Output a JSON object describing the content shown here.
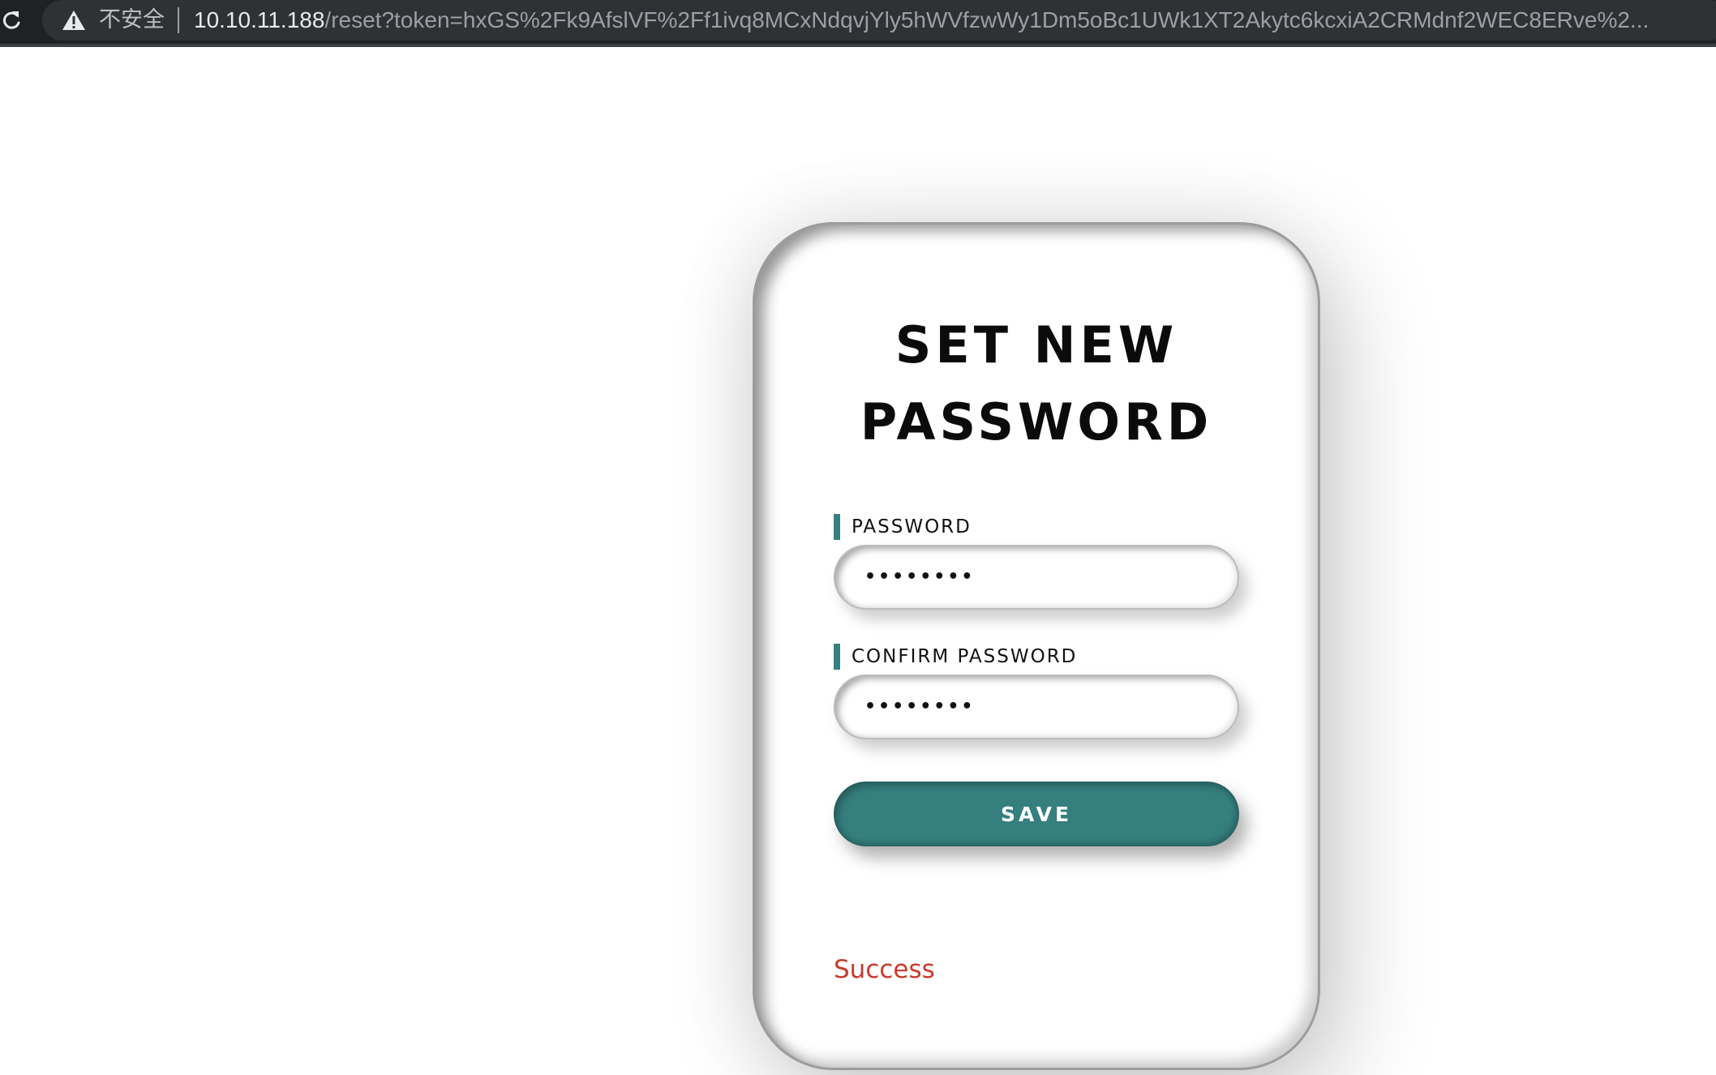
{
  "browser": {
    "security_label": "不安全",
    "url_host": "10.10.11.188",
    "url_path": "/reset?token=hxGS%2Fk9AfslVF%2Ff1ivq8MCxNdqvjYly5hWVfzwWy1Dm5oBc1UWk1XT2Akytc6kcxiA2CRMdnf2WEC8ERve%2...",
    "reload_icon": "reload-icon",
    "warning_icon": "warning-icon",
    "colors": {
      "bar_background": "#202124",
      "omnibox_background": "#303134",
      "host_text": "#e8eaed",
      "path_text": "#9aa0a6"
    }
  },
  "form": {
    "title_line1": "SET NEW",
    "title_line2": "PASSWORD",
    "password": {
      "label": "PASSWORD",
      "masked_value": "••••••••"
    },
    "confirm_password": {
      "label": "CONFIRM PASSWORD",
      "masked_value": "••••••••"
    },
    "save_label": "SAVE",
    "status_message": "Success",
    "colors": {
      "accent": "#357f7e",
      "status": "#c73a2b",
      "title": "#0b0b0b",
      "card_background": "#ffffff"
    }
  }
}
